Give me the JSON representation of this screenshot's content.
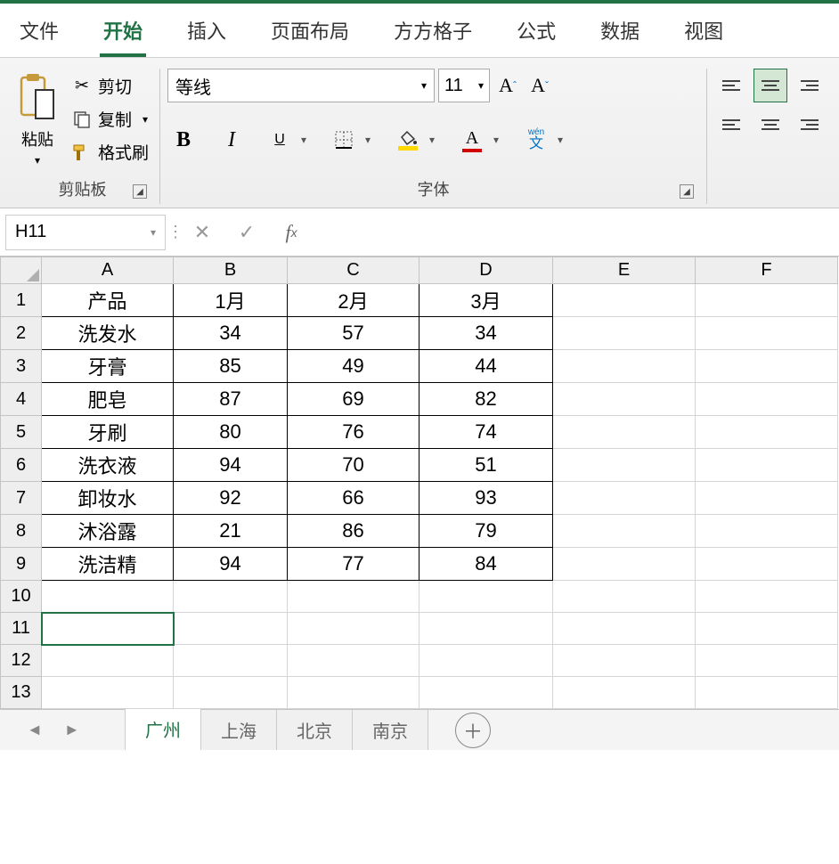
{
  "menu": {
    "items": [
      "文件",
      "开始",
      "插入",
      "页面布局",
      "方方格子",
      "公式",
      "数据",
      "视图"
    ],
    "active_index": 1
  },
  "ribbon": {
    "clipboard": {
      "paste": "粘贴",
      "cut": "剪切",
      "copy": "复制",
      "format_painter": "格式刷",
      "group_label": "剪贴板"
    },
    "font": {
      "name": "等线",
      "size": "11",
      "bold": "B",
      "italic": "I",
      "underline": "U",
      "group_label": "字体"
    }
  },
  "name_box": "H11",
  "columns": [
    "A",
    "B",
    "C",
    "D",
    "E",
    "F"
  ],
  "column_widths": [
    "colA",
    "colB",
    "colC",
    "colD",
    "colE",
    "colF"
  ],
  "row_count": 13,
  "data_rows": 9,
  "data_cols": 4,
  "selected": {
    "row": 11,
    "col": 0
  },
  "table": [
    [
      "产品",
      "1月",
      "2月",
      "3月"
    ],
    [
      "洗发水",
      "34",
      "57",
      "34"
    ],
    [
      "牙膏",
      "85",
      "49",
      "44"
    ],
    [
      "肥皂",
      "87",
      "69",
      "82"
    ],
    [
      "牙刷",
      "80",
      "76",
      "74"
    ],
    [
      "洗衣液",
      "94",
      "70",
      "51"
    ],
    [
      "卸妆水",
      "92",
      "66",
      "93"
    ],
    [
      "沐浴露",
      "21",
      "86",
      "79"
    ],
    [
      "洗洁精",
      "94",
      "77",
      "84"
    ]
  ],
  "sheets": {
    "tabs": [
      "广州",
      "上海",
      "北京",
      "南京"
    ],
    "active_index": 0
  }
}
